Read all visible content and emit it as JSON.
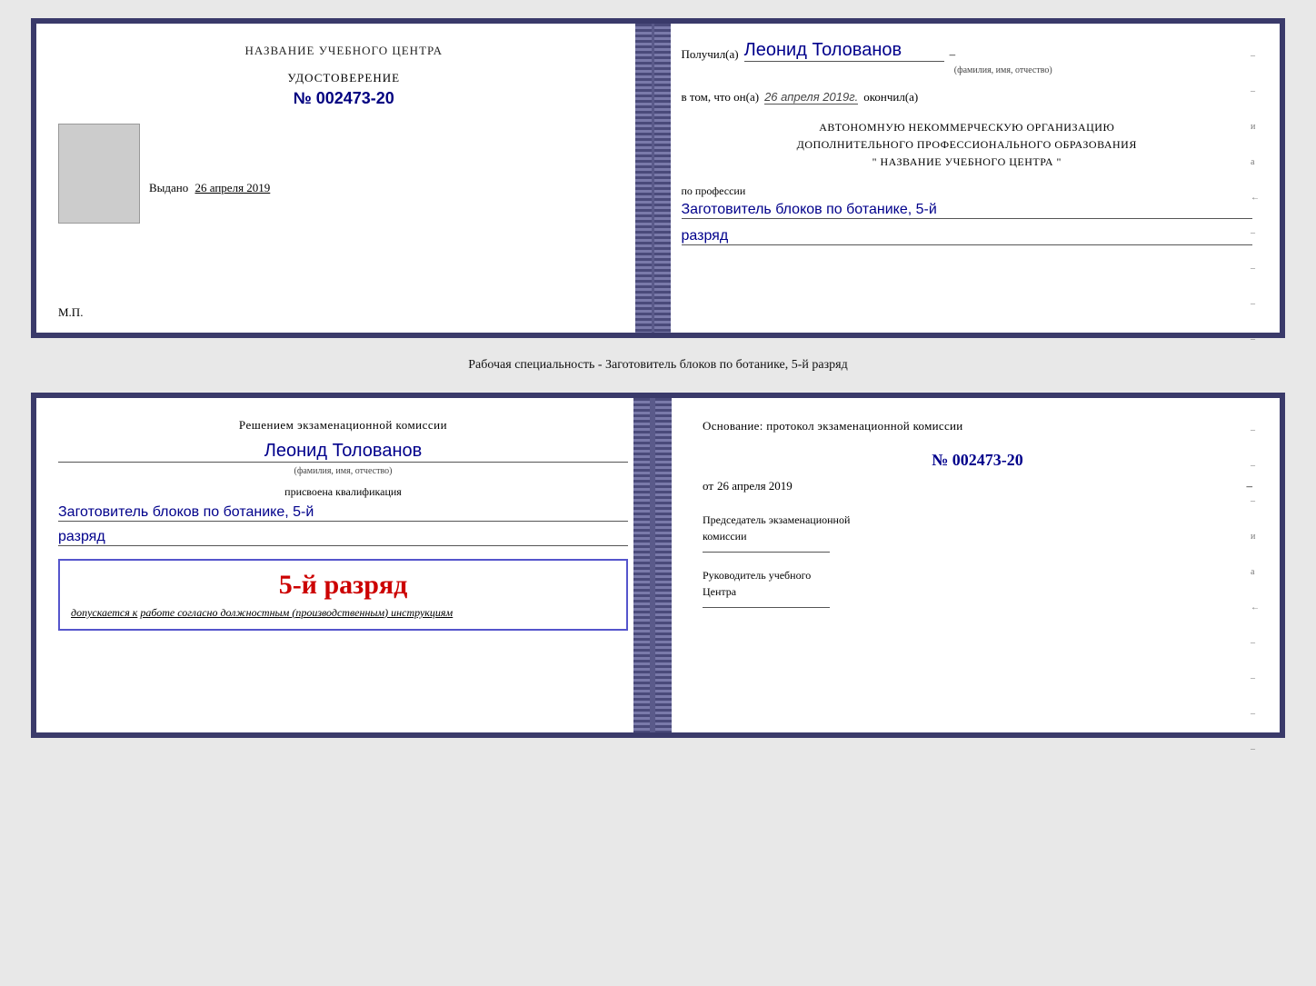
{
  "top_cert": {
    "left": {
      "title": "НАЗВАНИЕ УЧЕБНОГО ЦЕНТРА",
      "udostoverenie_label": "УДОСТОВЕРЕНИЕ",
      "number": "№ 002473-20",
      "vydano_label": "Выдано",
      "vydano_date": "26 апреля 2019",
      "mp_label": "М.П."
    },
    "right": {
      "poluchil_prefix": "Получил(а)",
      "recipient_name": "Леонид Толованов",
      "fio_subtitle": "(фамилия, имя, отчество)",
      "vtom_prefix": "в том, что он(а)",
      "vtom_date": "26 апреля 2019г.",
      "okončil_suffix": "окончил(а)",
      "org_line1": "АВТОНОМНУЮ НЕКОММЕРЧЕСКУЮ ОРГАНИЗАЦИЮ",
      "org_line2": "ДОПОЛНИТЕЛЬНОГО ПРОФЕССИОНАЛЬНОГО ОБРАЗОВАНИЯ",
      "org_line3": "\"  НАЗВАНИЕ УЧЕБНОГО ЦЕНТРА  \"",
      "po_professii_label": "по профессии",
      "profession": "Заготовитель блоков по ботанике, 5-й",
      "razryad": "разряд"
    }
  },
  "specialty_label": "Рабочая специальность - Заготовитель блоков по ботанике, 5-й разряд",
  "bottom_cert": {
    "left": {
      "resheniem_line": "Решением экзаменационной комиссии",
      "recipient_name": "Леонид Толованов",
      "fio_subtitle": "(фамилия, имя, отчество)",
      "prisvoena_label": "присвоена квалификация",
      "profession": "Заготовитель блоков по ботанике, 5-й",
      "razryad": "разряд",
      "big_razryad": "5-й разряд",
      "dopuskaetsya_prefix": "допускается к",
      "dopuskaetsya_text": "работе согласно должностным (производственным) инструкциям"
    },
    "right": {
      "osnovanie_text": "Основание: протокол экзаменационной комиссии",
      "protocol_number": "№  002473-20",
      "ot_prefix": "от",
      "ot_date": "26 апреля 2019",
      "predsedatel_line1": "Председатель экзаменационной",
      "predsedatel_line2": "комиссии",
      "rukovoditel_line1": "Руководитель учебного",
      "rukovoditel_line2": "Центра"
    }
  }
}
